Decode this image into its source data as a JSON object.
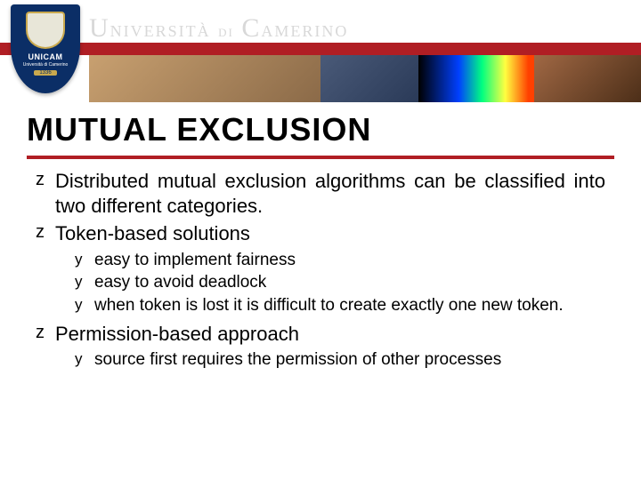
{
  "header": {
    "logo_main": "UNICAM",
    "logo_sub": "Università di Camerino",
    "logo_year": "1336",
    "university": "Università di Camerino"
  },
  "title": "MUTUAL EXCLUSION",
  "bullets": {
    "z": "z",
    "y": "y",
    "b1": "Distributed mutual exclusion algorithms can be classified into two different categories.",
    "b2": "Token-based solutions",
    "b2_1": "easy to implement fairness",
    "b2_2": "easy to avoid deadlock",
    "b2_3": "when token is lost it is difficult to create exactly one new token.",
    "b3": "Permission-based approach",
    "b3_1": "source first requires the permission of other processes"
  }
}
